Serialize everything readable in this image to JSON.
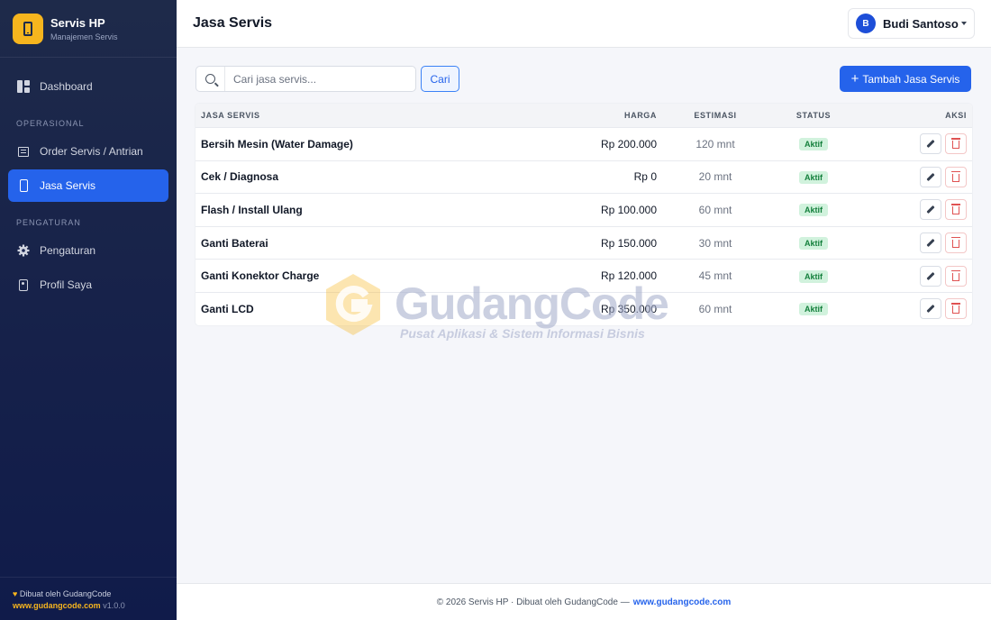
{
  "brand": {
    "title": "Servis HP",
    "subtitle": "Manajemen Servis"
  },
  "sidebar": {
    "items": [
      {
        "label": "Dashboard",
        "icon": "dashboard-icon"
      },
      {
        "label": "Order Servis / Antrian",
        "icon": "list-icon"
      },
      {
        "label": "Jasa Servis",
        "icon": "phone-icon",
        "active": true
      },
      {
        "label": "Pengaturan",
        "icon": "gear-icon"
      },
      {
        "label": "Profil Saya",
        "icon": "id-card-icon"
      }
    ],
    "sections": {
      "operasional": "OPERASIONAL",
      "pengaturan": "PENGATURAN"
    },
    "footer": {
      "made_by": "Dibuat oleh GudangCode",
      "url": "www.gudangcode.com",
      "version": "v1.0.0"
    }
  },
  "header": {
    "title": "Jasa Servis",
    "user": {
      "initial": "B",
      "name": "Budi Santoso"
    }
  },
  "toolbar": {
    "search_placeholder": "Cari jasa servis...",
    "search_button": "Cari",
    "add_button": "Tambah Jasa Servis"
  },
  "table": {
    "headers": {
      "name": "JASA SERVIS",
      "price": "HARGA",
      "estimate": "ESTIMASI",
      "status": "STATUS",
      "actions": "AKSI"
    },
    "rows": [
      {
        "name": "Bersih Mesin (Water Damage)",
        "price": "Rp 200.000",
        "estimate": "120 mnt",
        "status": "Aktif"
      },
      {
        "name": "Cek / Diagnosa",
        "price": "Rp 0",
        "estimate": "20 mnt",
        "status": "Aktif"
      },
      {
        "name": "Flash / Install Ulang",
        "price": "Rp 100.000",
        "estimate": "60 mnt",
        "status": "Aktif"
      },
      {
        "name": "Ganti Baterai",
        "price": "Rp 150.000",
        "estimate": "30 mnt",
        "status": "Aktif"
      },
      {
        "name": "Ganti Konektor Charge",
        "price": "Rp 120.000",
        "estimate": "45 mnt",
        "status": "Aktif"
      },
      {
        "name": "Ganti LCD",
        "price": "Rp 350.000",
        "estimate": "60 mnt",
        "status": "Aktif"
      }
    ]
  },
  "watermark": {
    "title": "GudangCode",
    "subtitle": "Pusat Aplikasi & Sistem Informasi Bisnis"
  },
  "footer": {
    "text": "© 2026 Servis HP · Dibuat oleh GudangCode —",
    "url": "www.gudangcode.com"
  },
  "colors": {
    "accent": "#2563eb",
    "brand": "#f6b51e",
    "sidebar": "#16214a",
    "status_active_bg": "#d1f2dd"
  }
}
